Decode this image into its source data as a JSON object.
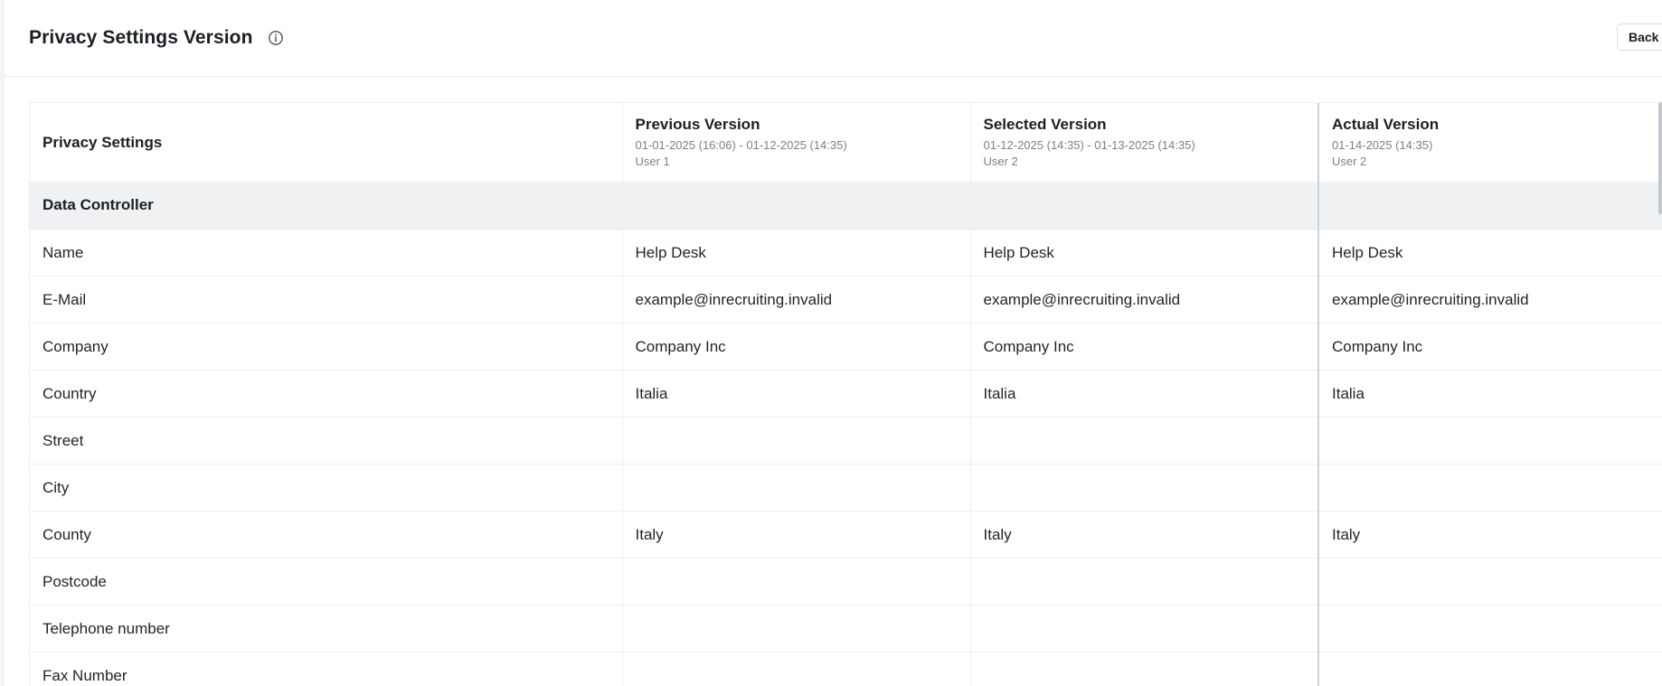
{
  "header": {
    "title": "Privacy Settings Version",
    "back_label": "Back"
  },
  "table": {
    "first_column_header": "Privacy Settings",
    "versions": [
      {
        "title": "Previous Version",
        "range": "01-01-2025 (16:06) - 01-12-2025 (14:35)",
        "user": "User 1"
      },
      {
        "title": "Selected Version",
        "range": "01-12-2025 (14:35) - 01-13-2025 (14:35)",
        "user": "User 2"
      },
      {
        "title": "Actual Version",
        "range": "01-14-2025 (14:35)",
        "user": "User 2"
      }
    ],
    "section": "Data Controller",
    "rows": [
      {
        "label": "Name",
        "values": [
          "Help Desk",
          "Help Desk",
          "Help Desk"
        ]
      },
      {
        "label": "E-Mail",
        "values": [
          "example@inrecruiting.invalid",
          "example@inrecruiting.invalid",
          "example@inrecruiting.invalid"
        ]
      },
      {
        "label": "Company",
        "values": [
          "Company Inc",
          "Company Inc",
          "Company Inc"
        ]
      },
      {
        "label": "Country",
        "values": [
          "Italia",
          "Italia",
          "Italia"
        ]
      },
      {
        "label": "Street",
        "values": [
          "",
          "",
          ""
        ]
      },
      {
        "label": "City",
        "values": [
          "",
          "",
          ""
        ]
      },
      {
        "label": "County",
        "values": [
          "Italy",
          "Italy",
          "Italy"
        ]
      },
      {
        "label": "Postcode",
        "values": [
          "",
          "",
          ""
        ]
      },
      {
        "label": "Telephone number",
        "values": [
          "",
          "",
          ""
        ]
      },
      {
        "label": "Fax Number",
        "values": [
          "",
          "",
          ""
        ]
      }
    ]
  },
  "colors": {
    "section_background": "#f0f1f3",
    "border": "#eceef1",
    "actual_divider": "#c9d3e0"
  },
  "icons": {
    "info": "info-icon"
  }
}
